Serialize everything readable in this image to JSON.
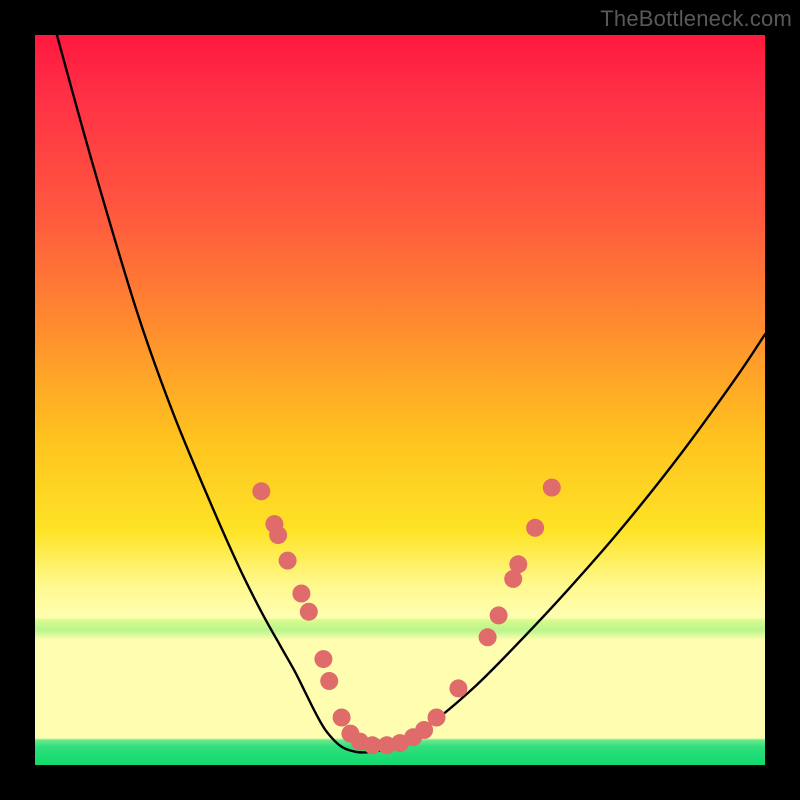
{
  "watermark": "TheBottleneck.com",
  "chart_data": {
    "type": "line",
    "title": "",
    "xlabel": "",
    "ylabel": "",
    "xlim": [
      0,
      100
    ],
    "ylim": [
      0,
      100
    ],
    "grid": false,
    "legend": false,
    "series": [
      {
        "name": "bottleneck-curve",
        "x": [
          3,
          8,
          14,
          19,
          24,
          28,
          31,
          33.5,
          35.5,
          37,
          38.5,
          40,
          42,
          44,
          46,
          49,
          54,
          60,
          66,
          73,
          80,
          88,
          96,
          100
        ],
        "y": [
          100,
          82,
          62,
          48,
          36,
          27,
          21,
          16.5,
          13,
          10,
          7,
          4.5,
          2.5,
          1.8,
          1.8,
          2.6,
          5.5,
          10.5,
          16.5,
          24,
          32,
          42,
          53,
          59
        ]
      }
    ],
    "markers": [
      {
        "name": "curve-dots",
        "color": "#df6b6b",
        "radius": 9,
        "points": [
          {
            "x": 31.0,
            "y": 37.5
          },
          {
            "x": 32.8,
            "y": 33.0
          },
          {
            "x": 33.3,
            "y": 31.5
          },
          {
            "x": 34.6,
            "y": 28.0
          },
          {
            "x": 36.5,
            "y": 23.5
          },
          {
            "x": 37.5,
            "y": 21.0
          },
          {
            "x": 39.5,
            "y": 14.5
          },
          {
            "x": 40.3,
            "y": 11.5
          },
          {
            "x": 42.0,
            "y": 6.5
          },
          {
            "x": 43.2,
            "y": 4.3
          },
          {
            "x": 44.5,
            "y": 3.2
          },
          {
            "x": 46.2,
            "y": 2.7
          },
          {
            "x": 48.2,
            "y": 2.7
          },
          {
            "x": 50.0,
            "y": 3.0
          },
          {
            "x": 51.8,
            "y": 3.8
          },
          {
            "x": 53.3,
            "y": 4.8
          },
          {
            "x": 55.0,
            "y": 6.5
          },
          {
            "x": 58.0,
            "y": 10.5
          },
          {
            "x": 62.0,
            "y": 17.5
          },
          {
            "x": 63.5,
            "y": 20.5
          },
          {
            "x": 65.5,
            "y": 25.5
          },
          {
            "x": 66.2,
            "y": 27.5
          },
          {
            "x": 68.5,
            "y": 32.5
          },
          {
            "x": 70.8,
            "y": 38.0
          }
        ]
      }
    ]
  }
}
